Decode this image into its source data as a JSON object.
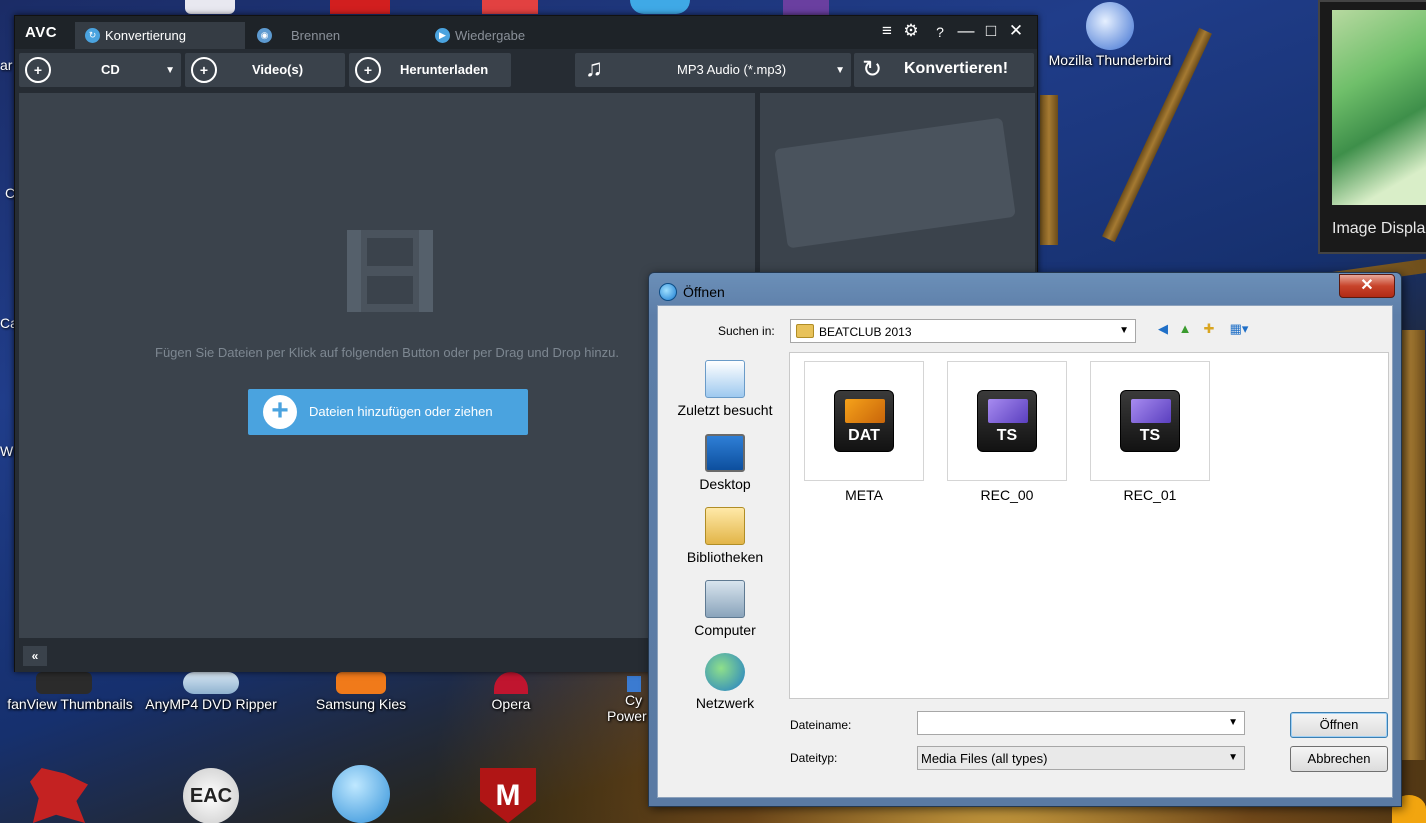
{
  "desktop": {
    "photo_caption": "Image Displa",
    "thunderbird_label": "Mozilla Thunderbird",
    "row_icons": [
      {
        "label": "fanView Thumbnails"
      },
      {
        "label": "AnyMP4 DVD Ripper"
      },
      {
        "label": "Samsung Kies"
      },
      {
        "label": "Opera"
      }
    ],
    "cyberlink_top": "Cy",
    "cyberlink_bottom": "Power",
    "edge_texts": [
      "ar",
      "C",
      "Ca",
      "Wi"
    ],
    "bottom_icons": [
      {
        "label": "EAC"
      },
      {
        "label": "M"
      }
    ]
  },
  "avc": {
    "logo": "AVC",
    "tabs": [
      {
        "label": "Konvertierung",
        "icon": "refresh-icon"
      },
      {
        "label": "Brennen",
        "icon": "disc-icon"
      },
      {
        "label": "Wiedergabe",
        "icon": "play-icon"
      }
    ],
    "window_controls": {
      "menu": "≡",
      "settings": "⚙",
      "help": "?",
      "minimize": "—",
      "maximize": "□",
      "close": "✕"
    },
    "toolbar": {
      "cd_label": "CD",
      "videos_label": "Video(s)",
      "download_label": "Herunterladen",
      "format_label": "MP3 Audio (*.mp3)",
      "convert_label": "Konvertieren!"
    },
    "drop_hint": "Fügen Sie Dateien per Klick auf folgenden Button oder per Drag und Drop hinzu.",
    "add_button_label": "Dateien hinzufügen oder ziehen",
    "collapse_label": "«",
    "accent_color": "#4aa3df"
  },
  "dialog": {
    "title": "Öffnen",
    "close_label": "✕",
    "look_in_label": "Suchen in:",
    "look_in_value": "BEATCLUB 2013",
    "places": [
      {
        "label": "Zuletzt besucht",
        "icon": "recent-places-icon"
      },
      {
        "label": "Desktop",
        "icon": "desktop-icon"
      },
      {
        "label": "Bibliotheken",
        "icon": "libraries-icon"
      },
      {
        "label": "Computer",
        "icon": "computer-icon"
      },
      {
        "label": "Netzwerk",
        "icon": "network-icon"
      }
    ],
    "files": [
      {
        "name": "META",
        "ext": "DAT"
      },
      {
        "name": "REC_00",
        "ext": "TS"
      },
      {
        "name": "REC_01",
        "ext": "TS"
      }
    ],
    "filename_label": "Dateiname:",
    "filename_value": "",
    "filetype_label": "Dateityp:",
    "filetype_value": "Media Files (all types)",
    "open_button": "Öffnen",
    "cancel_button": "Abbrechen"
  }
}
